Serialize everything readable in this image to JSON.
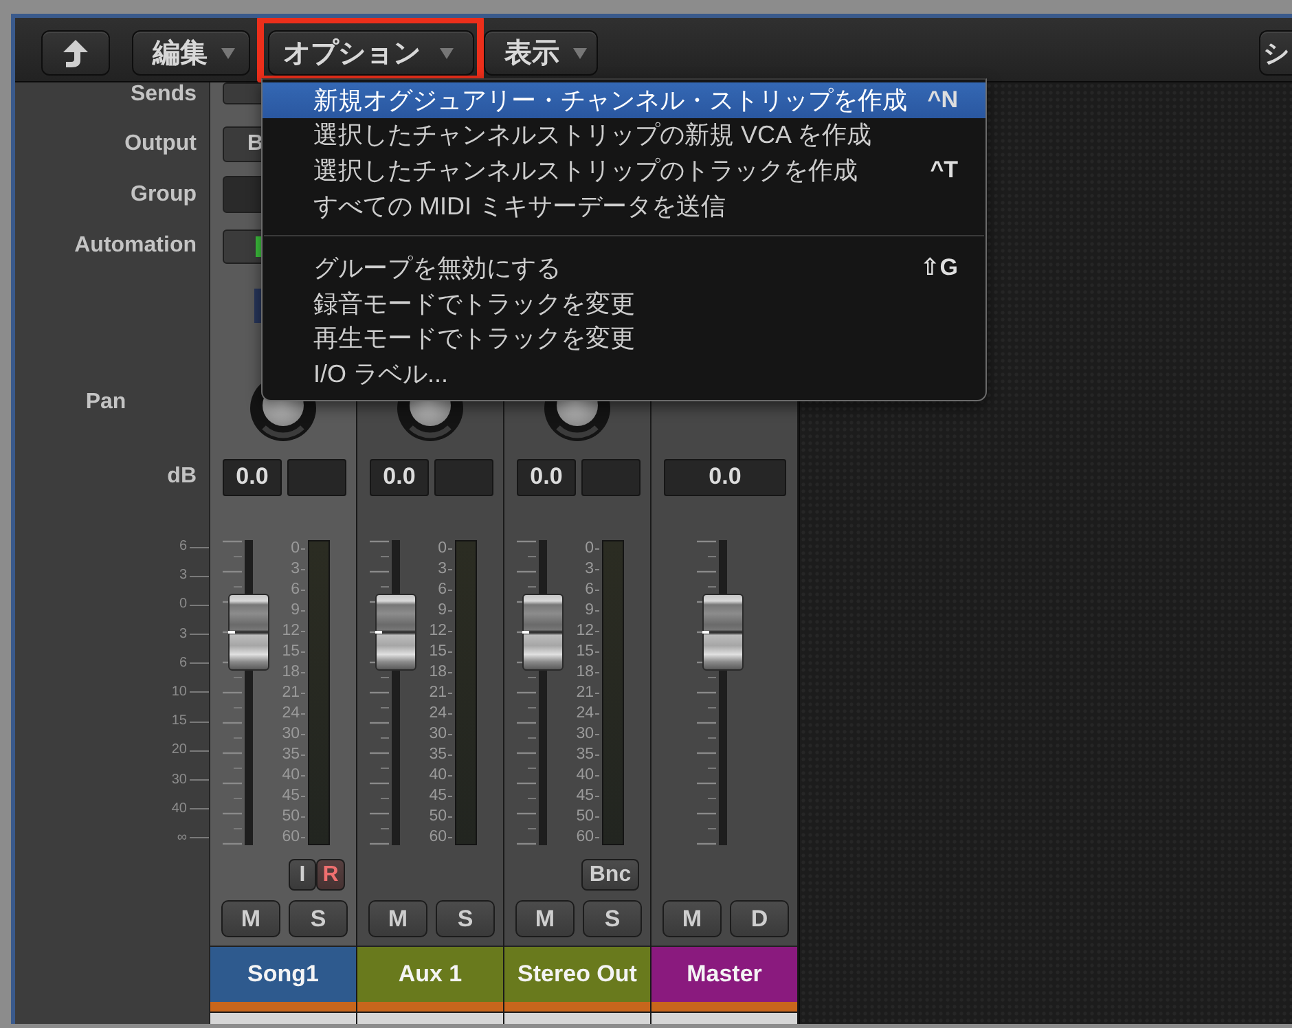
{
  "toolbar": {
    "menus": [
      {
        "label": "編集",
        "annotated": false
      },
      {
        "label": "オプション",
        "annotated": true
      },
      {
        "label": "表示",
        "annotated": false
      }
    ],
    "right_button": "シ"
  },
  "dropdown_menu": {
    "sections": [
      {
        "items": [
          {
            "label": "新規オグジュアリー・チャンネル・ストリップを作成",
            "shortcut": "^N",
            "selected": true
          },
          {
            "label": "選択したチャンネルストリップの新規 VCA を作成",
            "selected": false
          },
          {
            "label": "選択したチャンネルストリップのトラックを作成",
            "shortcut": "^T",
            "selected": false
          },
          {
            "label": "すべての MIDI ミキサーデータを送信",
            "selected": false
          }
        ]
      },
      {
        "items": [
          {
            "label": "グループを無効にする",
            "shortcut": "⇧G",
            "selected": false
          },
          {
            "label": "録音モードでトラックを変更",
            "selected": false
          },
          {
            "label": "再生モードでトラックを変更",
            "selected": false
          },
          {
            "label": "I/O ラベル...",
            "selected": false
          }
        ]
      }
    ]
  },
  "row_labels": {
    "sends": "Sends",
    "output": "Output",
    "group": "Group",
    "automation": "Automation",
    "pan": "Pan",
    "db": "dB"
  },
  "label_scale": [
    "6",
    "3",
    "0",
    "3",
    "6",
    "10",
    "15",
    "20",
    "30",
    "40",
    "∞"
  ],
  "strips": [
    {
      "kind": "channel",
      "name": "Song1",
      "color": "#2e5a8e",
      "selected": true,
      "output": "B",
      "automation": {
        "active": true
      },
      "db": "0.0",
      "fader": {
        "level": 0.7
      },
      "meter_scale": [
        "0",
        "3",
        "6",
        "9",
        "12",
        "15",
        "18",
        "21",
        "24",
        "30",
        "35",
        "40",
        "45",
        "50",
        "60"
      ],
      "io_buttons": [
        {
          "kind": "input-monitor",
          "label": "I",
          "on": false
        },
        {
          "kind": "record",
          "label": "R",
          "on": true
        }
      ],
      "ms_buttons": [
        {
          "label": "M",
          "on": false
        },
        {
          "label": "S",
          "on": false
        }
      ]
    },
    {
      "kind": "channel",
      "name": "Aux 1",
      "color": "#697a1d",
      "selected": false,
      "db": "0.0",
      "fader": {
        "level": 0.7
      },
      "meter_scale": [
        "0",
        "3",
        "6",
        "9",
        "12",
        "15",
        "18",
        "21",
        "24",
        "30",
        "35",
        "40",
        "45",
        "50",
        "60"
      ],
      "ms_buttons": [
        {
          "label": "M",
          "on": false
        },
        {
          "label": "S",
          "on": false
        }
      ]
    },
    {
      "kind": "channel",
      "name": "Stereo Out",
      "color": "#697a1d",
      "selected": false,
      "db": "0.0",
      "fader": {
        "level": 0.7
      },
      "meter_scale": [
        "0",
        "3",
        "6",
        "9",
        "12",
        "15",
        "18",
        "21",
        "24",
        "30",
        "35",
        "40",
        "45",
        "50",
        "60"
      ],
      "io_buttons": [
        {
          "kind": "bounce",
          "label": "Bnc",
          "on": false
        }
      ],
      "ms_buttons": [
        {
          "label": "M",
          "on": false
        },
        {
          "label": "S",
          "on": false
        }
      ]
    },
    {
      "kind": "master",
      "name": "Master",
      "color": "#8a1a7e",
      "selected": false,
      "db": "0.0",
      "fader": {
        "level": 0.7
      },
      "ms_buttons": [
        {
          "label": "M",
          "on": false
        },
        {
          "label": "D",
          "on": false
        }
      ]
    }
  ]
}
